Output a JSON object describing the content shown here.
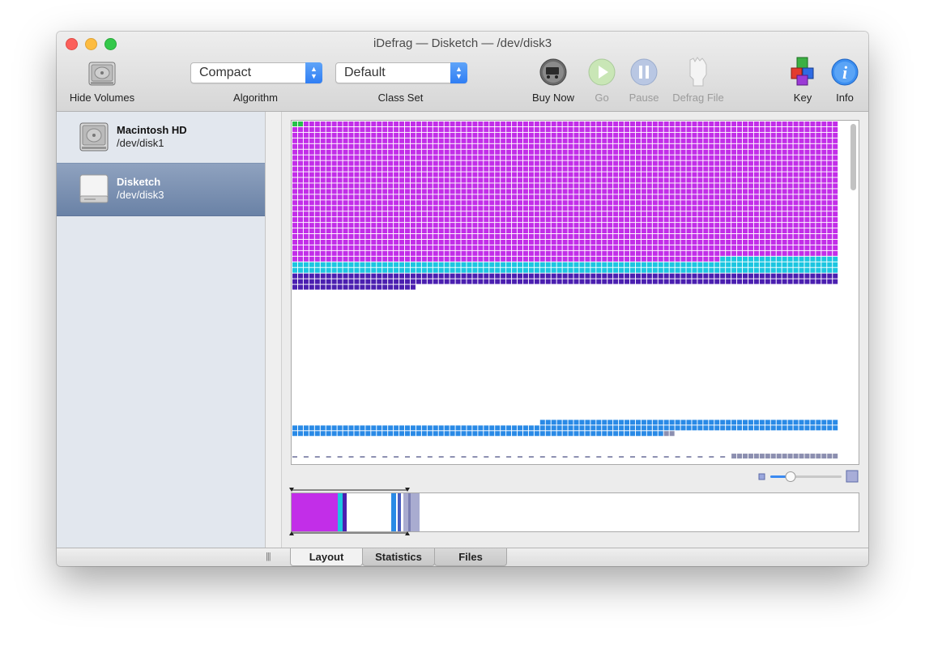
{
  "window": {
    "title": "iDefrag — Disketch — /dev/disk3"
  },
  "toolbar": {
    "hide_volumes": "Hide Volumes",
    "algorithm_label": "Algorithm",
    "algorithm_value": "Compact",
    "class_set_label": "Class Set",
    "class_set_value": "Default",
    "buy_now": "Buy Now",
    "go": "Go",
    "pause": "Pause",
    "defrag_file": "Defrag File",
    "key": "Key",
    "info": "Info"
  },
  "sidebar": {
    "volumes": [
      {
        "name": "Macintosh HD",
        "device": "/dev/disk1",
        "selected": false
      },
      {
        "name": "Disketch",
        "device": "/dev/disk3",
        "selected": true
      }
    ]
  },
  "disk_map": {
    "colors": {
      "magenta": "#c22ee8",
      "cyan": "#1cc6e0",
      "indigo": "#4b1fb0",
      "blue": "#2a8ae6",
      "green": "#27c24a",
      "grey": "#8c8fb0",
      "empty": "#ffffff"
    }
  },
  "tabs": {
    "layout": "Layout",
    "statistics": "Statistics",
    "files": "Files"
  }
}
